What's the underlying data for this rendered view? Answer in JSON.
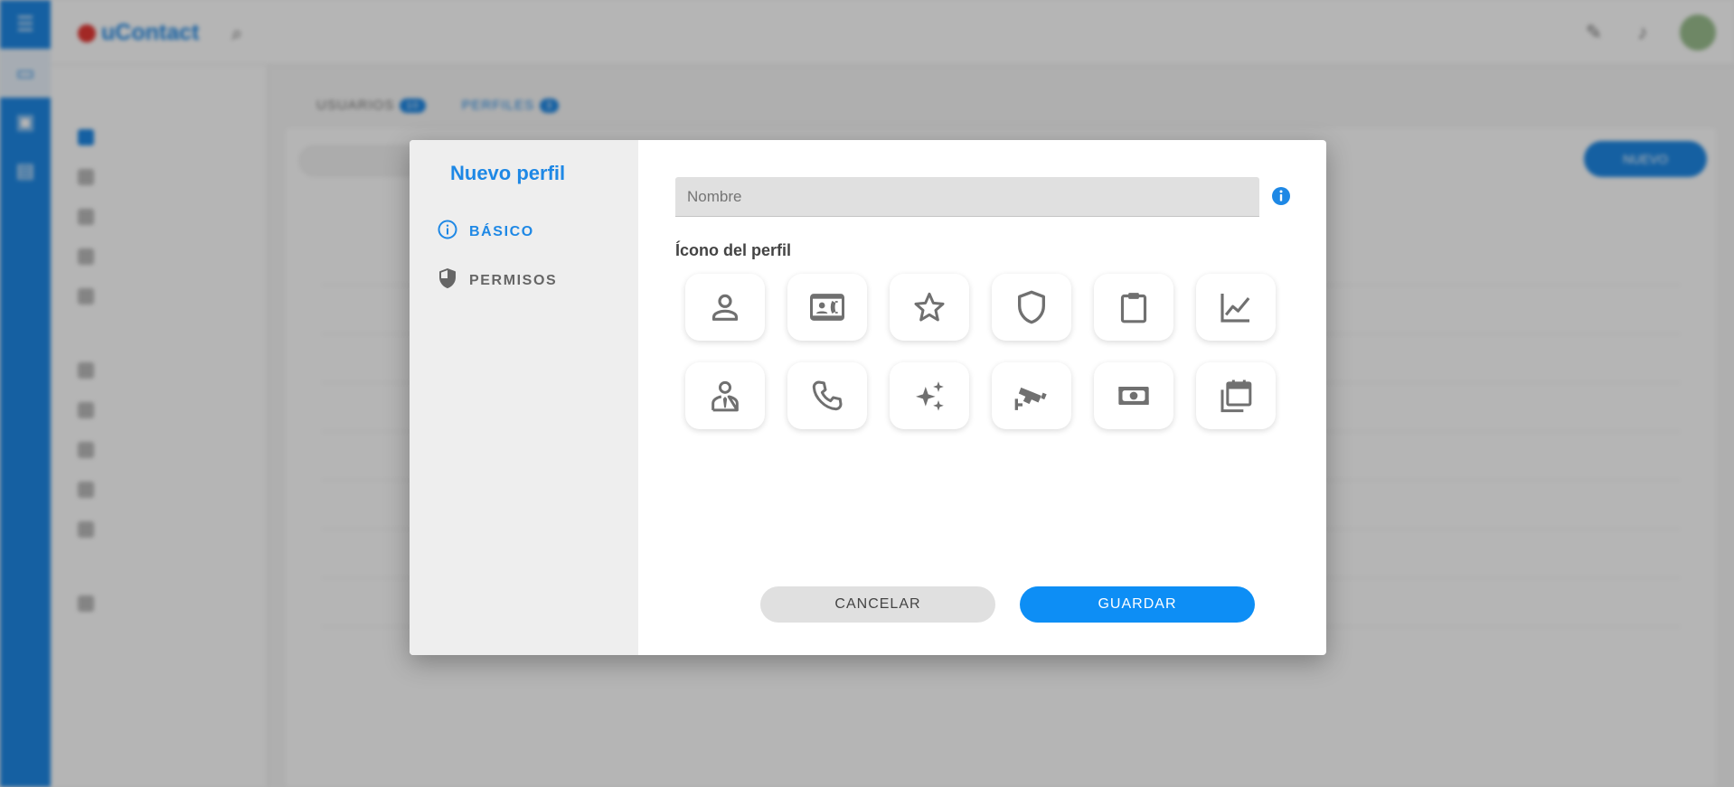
{
  "background": {
    "brand": "uContact",
    "tabs": [
      {
        "label": "USUARIOS",
        "badge": "10"
      },
      {
        "label": "PERFILES",
        "badge": "3"
      }
    ],
    "new_button": "NUEVO"
  },
  "modal": {
    "title": "Nuevo perfil",
    "nav": [
      {
        "label": "BÁSICO",
        "icon": "info-circle-icon",
        "active": true
      },
      {
        "label": "PERMISOS",
        "icon": "shield-icon",
        "active": false
      }
    ],
    "name_placeholder": "Nombre",
    "name_value": "",
    "icon_section_label": "Ícono del perfil",
    "icons": [
      "person-icon",
      "contact-card-icon",
      "star-icon",
      "shield-outline-icon",
      "clipboard-icon",
      "chart-line-icon",
      "agent-icon",
      "phone-icon",
      "sparkles-icon",
      "security-camera-icon",
      "money-icon",
      "calendar-multiple-icon"
    ],
    "cancel_label": "CANCELAR",
    "save_label": "GUARDAR"
  },
  "colors": {
    "accent": "#1e88e5",
    "save_button": "#0d8ef5",
    "icon_gray": "#707070",
    "sidebar_bg": "#eeeeee"
  }
}
